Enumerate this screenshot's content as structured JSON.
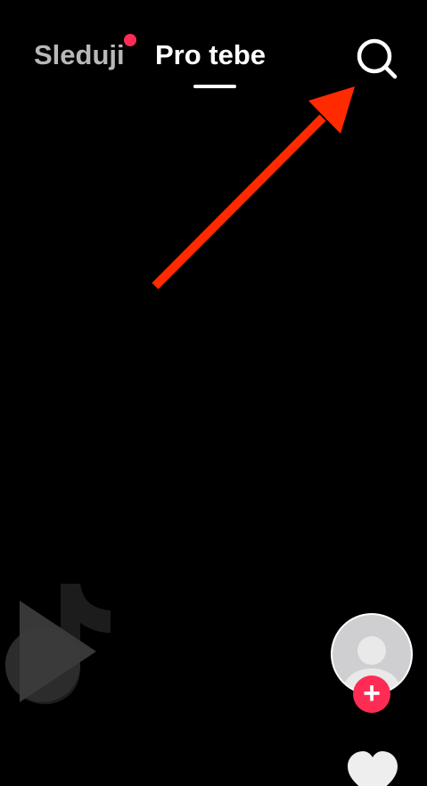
{
  "top_nav": {
    "tabs": [
      {
        "label": "Sleduji",
        "active": false,
        "has_notification": true
      },
      {
        "label": "Pro tebe",
        "active": true
      }
    ],
    "search_icon": "search-icon"
  },
  "annotation": {
    "icon": "arrow-icon",
    "color": "#ff2a00"
  },
  "right_rail": {
    "avatar_icon": "default-avatar-icon",
    "follow_label": "+",
    "like_icon": "heart-icon"
  },
  "watermark": {
    "icon": "tiktok-logo-icon"
  },
  "colors": {
    "background": "#000000",
    "accent": "#fe2c55",
    "inactive_tab": "#b8b8b8",
    "active_tab": "#ffffff"
  }
}
